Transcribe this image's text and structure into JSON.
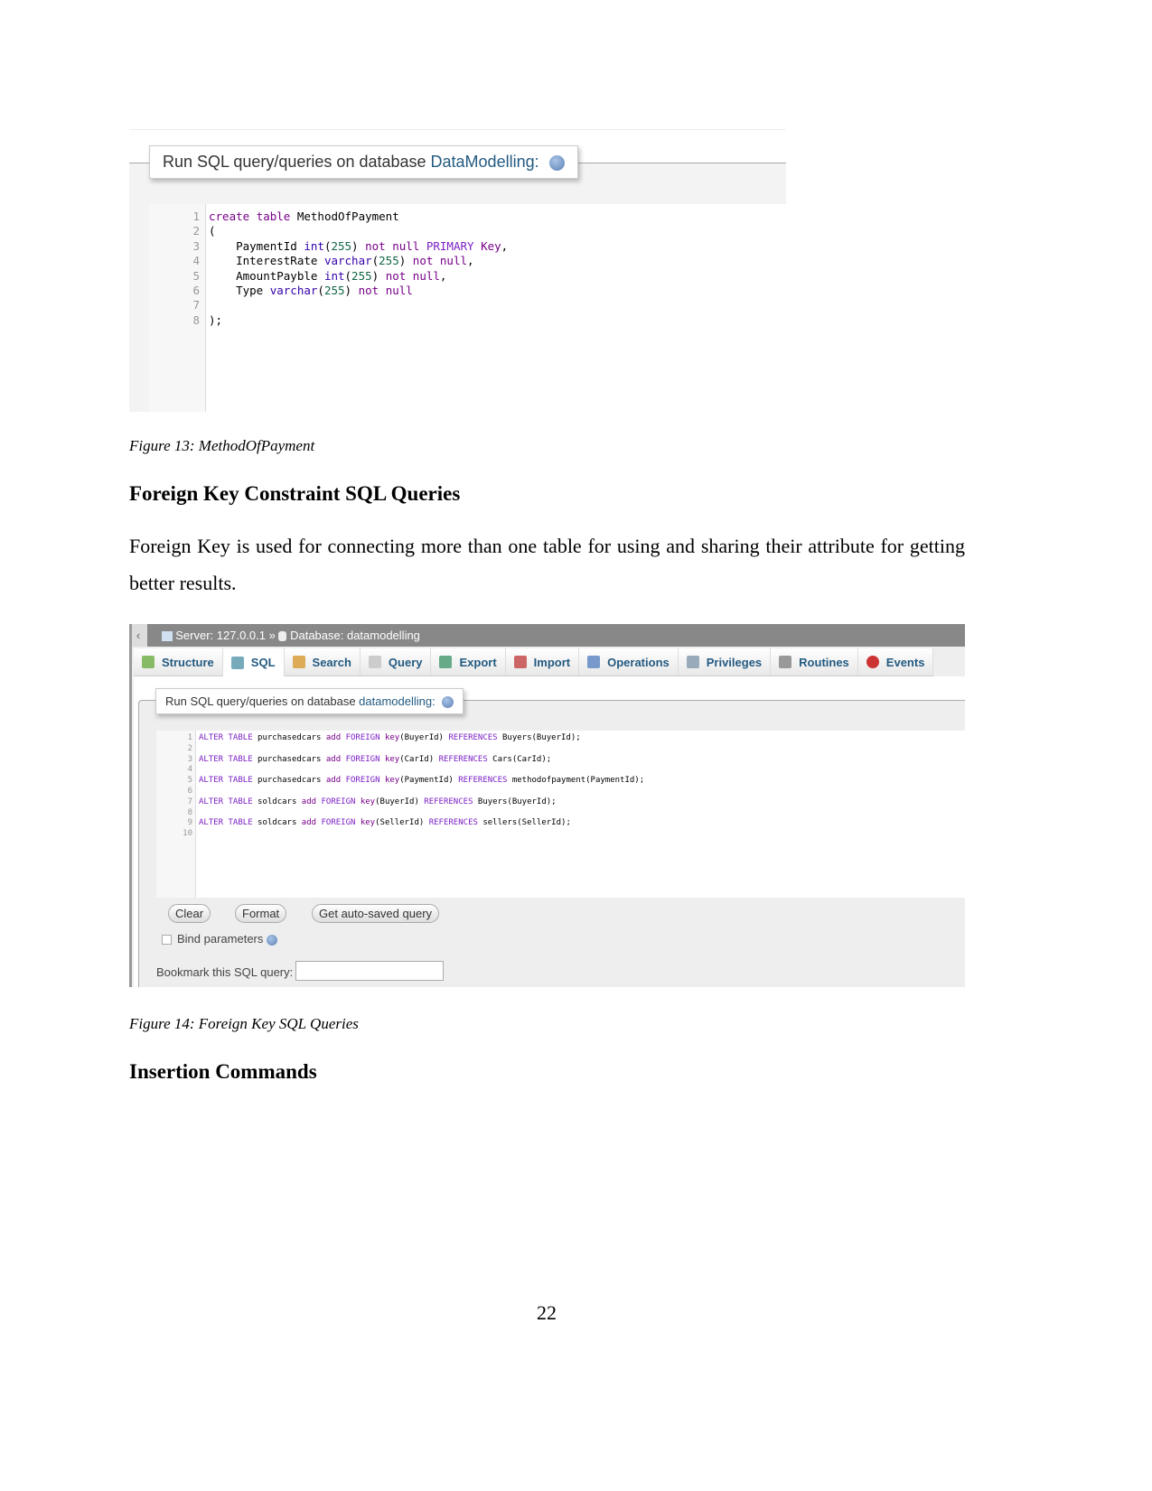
{
  "figure1": {
    "legend_prefix": "Run SQL query/queries on database ",
    "database": "DataModelling:",
    "icon": "help-icon",
    "code": [
      "create table MethodOfPayment",
      "(",
      "    PaymentId int(255) not null PRIMARY Key,",
      "    InterestRate varchar(255) not null,",
      "    AmountPayble int(255) not null,",
      "    Type varchar(255) not null",
      "",
      ");"
    ],
    "caption": "Figure 13: MethodOfPayment"
  },
  "heading1": "Foreign Key Constraint SQL Queries",
  "paragraph1": "Foreign Key is used for connecting more than one table for using and sharing their attribute for getting better results.",
  "figure2": {
    "breadcrumb": {
      "server": "Server: 127.0.0.1",
      "separator": "»",
      "database": "Database: datamodelling"
    },
    "tabs": [
      {
        "label": "Structure",
        "icon": "structure-icon"
      },
      {
        "label": "SQL",
        "icon": "sql-icon"
      },
      {
        "label": "Search",
        "icon": "search-icon"
      },
      {
        "label": "Query",
        "icon": "query-icon"
      },
      {
        "label": "Export",
        "icon": "export-icon"
      },
      {
        "label": "Import",
        "icon": "import-icon"
      },
      {
        "label": "Operations",
        "icon": "wrench-icon"
      },
      {
        "label": "Privileges",
        "icon": "privileges-icon"
      },
      {
        "label": "Routines",
        "icon": "routines-icon"
      },
      {
        "label": "Events",
        "icon": "clock-icon"
      }
    ],
    "active_tab": "SQL",
    "legend_prefix": "Run SQL query/queries on database ",
    "database": "datamodelling:",
    "code": [
      "ALTER TABLE purchasedcars add FOREIGN key(BuyerId) REFERENCES Buyers(BuyerId);",
      "",
      "ALTER TABLE purchasedcars add FOREIGN key(CarId) REFERENCES Cars(CarId);",
      "",
      "ALTER TABLE purchasedcars add FOREIGN key(PaymentId) REFERENCES methodofpayment(PaymentId);",
      "",
      "ALTER TABLE soldcars add FOREIGN key(BuyerId) REFERENCES Buyers(BuyerId);",
      "",
      "ALTER TABLE soldcars add FOREIGN key(SellerId) REFERENCES sellers(SellerId);",
      ""
    ],
    "buttons": {
      "clear": "Clear",
      "format": "Format",
      "autosaved": "Get auto-saved query"
    },
    "bind_parameters": "Bind parameters",
    "bind_checked": false,
    "bookmark_label": "Bookmark this SQL query:",
    "bookmark_value": "",
    "caption": "Figure 14: Foreign Key SQL Queries"
  },
  "heading2": "Insertion Commands",
  "page_number": "22"
}
